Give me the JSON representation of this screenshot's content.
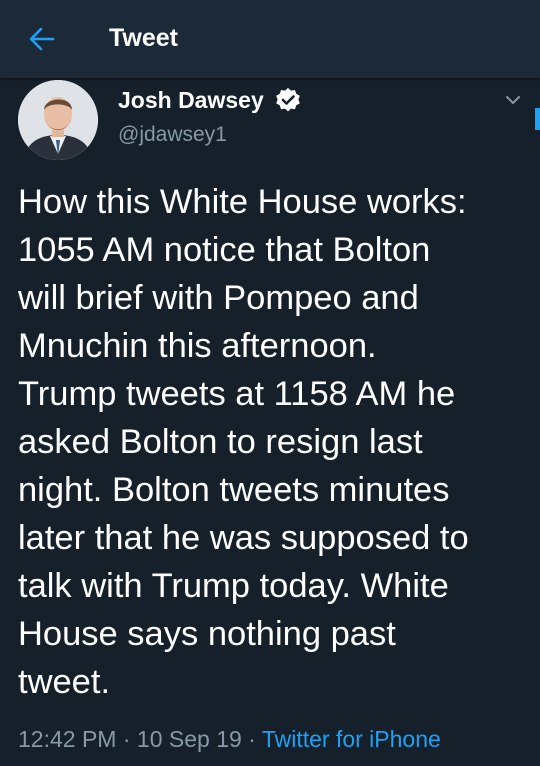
{
  "header": {
    "title": "Tweet",
    "back_icon": "arrow-left-icon"
  },
  "tweet": {
    "author": {
      "name": "Josh Dawsey",
      "handle": "@jdawsey1",
      "verified_icon": "verified-badge-icon",
      "avatar": "profile-photo"
    },
    "menu_icon": "chevron-down-icon",
    "text": "How this White House works:\n1055 AM notice that Bolton\nwill brief with Pompeo and\nMnuchin this afternoon.\nTrump tweets at 1158 AM he\nasked Bolton to resign last\nnight. Bolton tweets minutes\nlater that he was supposed to\ntalk with Trump today. White\nHouse says nothing past\ntweet.",
    "time": "12:42 PM",
    "separator": "·",
    "date": "10 Sep 19",
    "source": "Twitter for iPhone"
  },
  "colors": {
    "background": "#15202b",
    "header": "#1c2938",
    "accent": "#1da1f2",
    "secondary_text": "#8899a6"
  }
}
